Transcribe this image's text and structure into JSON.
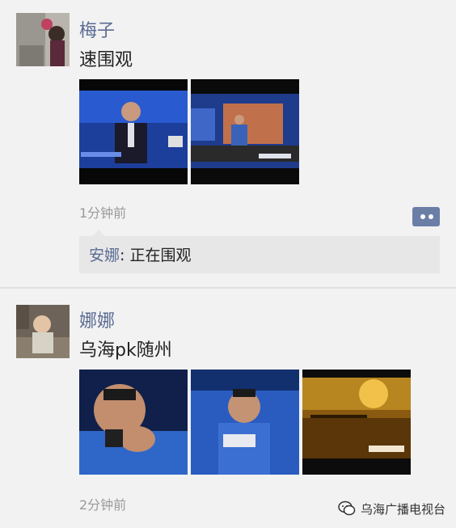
{
  "posts": [
    {
      "author": "梅子",
      "text": "速围观",
      "time": "1分钟前",
      "comments": [
        {
          "author": "安娜",
          "separator": ": ",
          "text": "正在围观"
        }
      ]
    },
    {
      "author": "娜娜",
      "text": "乌海pk随州",
      "time": "2分钟前",
      "comments": []
    }
  ],
  "watermark": {
    "text": "乌海广播电视台",
    "icon": "wechat-icon"
  },
  "colors": {
    "name": "#5a6b93",
    "background": "#f2f2f2",
    "comment_bg": "#e7e7e7",
    "comment_button": "#6b7ea6"
  }
}
